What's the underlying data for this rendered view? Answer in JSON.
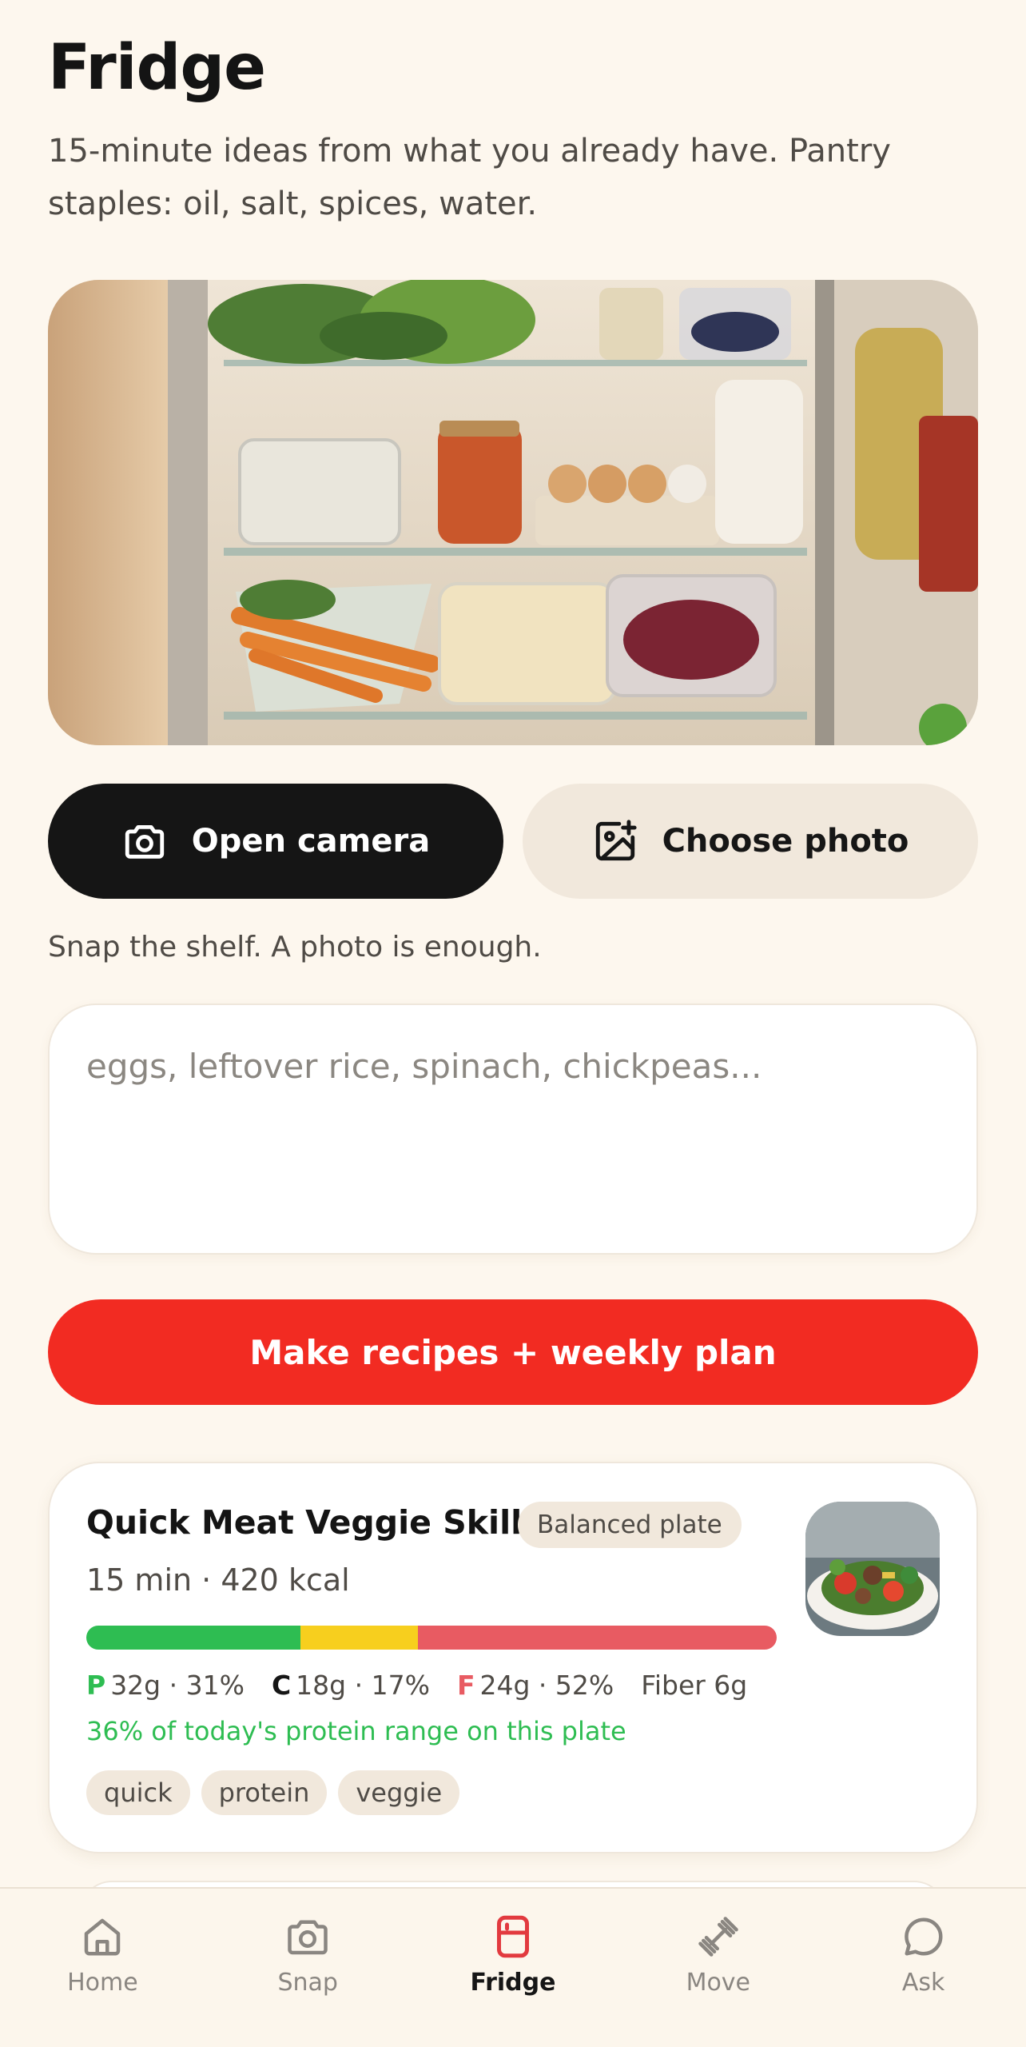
{
  "header": {
    "title": "Fridge",
    "subtitle": "15-minute ideas from what you already have. Pantry staples: oil, salt, spices, water."
  },
  "actions": {
    "camera_label": "Open camera",
    "photo_label": "Choose photo",
    "hint": "Snap the shelf. A photo is enough."
  },
  "ingredients": {
    "value": "",
    "placeholder": "eggs, leftover rice, spinach, chickpeas..."
  },
  "make_button_label": "Make recipes + weekly plan",
  "recipe": {
    "title": "Quick Meat Veggie Skillet",
    "badge": "Balanced plate",
    "meta": "15 min · 420 kcal",
    "macros": {
      "protein": {
        "letter": "P",
        "text": "32g · 31%",
        "percent": 31,
        "color": "#2ebd52"
      },
      "carbs": {
        "letter": "C",
        "text": "18g · 17%",
        "percent": 17,
        "color": "#f7cf1e"
      },
      "fat": {
        "letter": "F",
        "text": "24g · 52%",
        "percent": 52,
        "color": "#e85b62"
      }
    },
    "fiber": "Fiber 6g",
    "protein_note": "36% of today's protein range on this plate",
    "tags": [
      "quick",
      "protein",
      "veggie"
    ]
  },
  "nav": {
    "items": [
      {
        "label": "Home",
        "icon": "home-icon"
      },
      {
        "label": "Snap",
        "icon": "camera-icon"
      },
      {
        "label": "Fridge",
        "icon": "fridge-icon",
        "active": true
      },
      {
        "label": "Move",
        "icon": "dumbbell-icon"
      },
      {
        "label": "Ask",
        "icon": "chat-bubble-icon"
      }
    ]
  },
  "colors": {
    "background": "#fdf7ee",
    "primary_dark": "#151515",
    "accent_red": "#f22b22",
    "chip": "#f1e8dc",
    "fridge_icon_accent": "#e23a3f"
  }
}
